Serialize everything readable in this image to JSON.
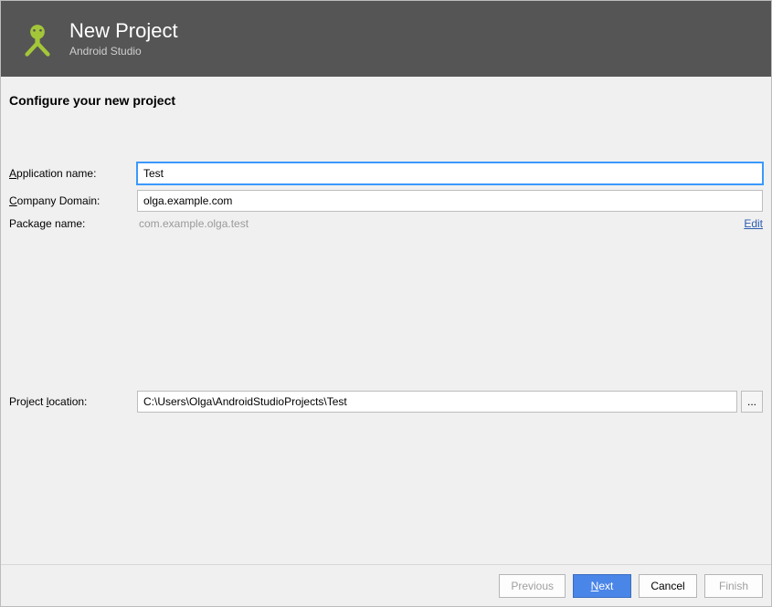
{
  "header": {
    "title": "New Project",
    "subtitle": "Android Studio"
  },
  "section": {
    "title": "Configure your new project"
  },
  "form": {
    "app_name_label": "Application name:",
    "app_name_value": "Test",
    "company_domain_label": "Company Domain:",
    "company_domain_value": "olga.example.com",
    "package_name_label": "Package name:",
    "package_name_value": "com.example.olga.test",
    "edit_link": "Edit",
    "project_location_label": "Project location:",
    "project_location_value": "C:\\Users\\Olga\\AndroidStudioProjects\\Test",
    "browse_label": "..."
  },
  "footer": {
    "previous": "Previous",
    "next": "Next",
    "cancel": "Cancel",
    "finish": "Finish"
  }
}
